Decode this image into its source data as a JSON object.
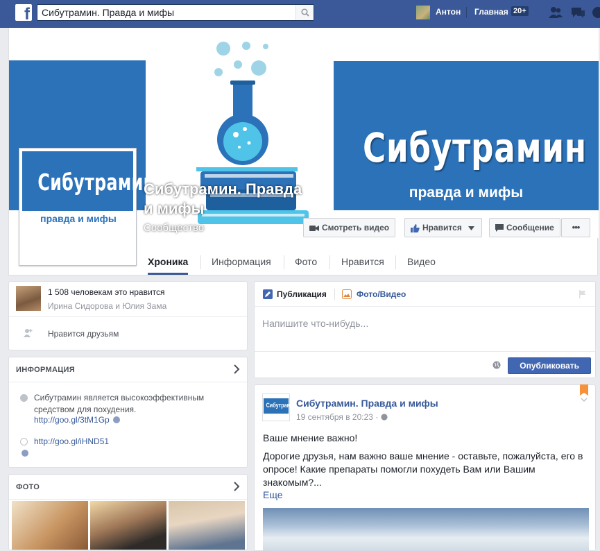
{
  "topbar": {
    "search_value": "Сибутрамин. Правда и мифы",
    "user_name": "Антон",
    "home_label": "Главная",
    "home_count": "20+"
  },
  "cover": {
    "banner_title": "Сибутрамин",
    "banner_subtitle": "правда и мифы",
    "page_name": "Сибутрамин. Правда и мифы",
    "category": "Сообщество",
    "buttons": {
      "watch_video": "Смотреть видео",
      "like": "Нравится",
      "message": "Сообщение",
      "more": "•••"
    }
  },
  "tabs": [
    "Хроника",
    "Информация",
    "Фото",
    "Нравится",
    "Видео"
  ],
  "likes": {
    "count_text": "1 508 человекам это нравится",
    "friends_text": "Ирина Сидорова и Юлия Зама",
    "friends_like": "Нравится друзьям"
  },
  "info": {
    "title": "ИНФОРМАЦИЯ",
    "description": "Сибутрамин является высокоэффективным средством для похудения.",
    "link1": "http://goo.gl/3tM1Gp",
    "link2": "http://goo.gl/iHND51"
  },
  "photos": {
    "title": "ФОТО"
  },
  "composer": {
    "tab_post": "Публикация",
    "tab_photo": "Фото/Видео",
    "placeholder": "Напишите что-нибудь...",
    "publish": "Опубликовать"
  },
  "post": {
    "author": "Сибутрамин. Правда и мифы",
    "time": "19 сентября в 20:23 · ",
    "line1": "Ваше мнение важно!",
    "body": "Дорогие друзья, нам важно ваше мнение - оставьте, пожалуйста, его в опросе! Какие препараты помогли похудеть Вам или Вашим знакомым?...",
    "more": "Еще"
  },
  "colors": {
    "brand": "#3b5998",
    "banner_blue": "#2b72b9"
  }
}
